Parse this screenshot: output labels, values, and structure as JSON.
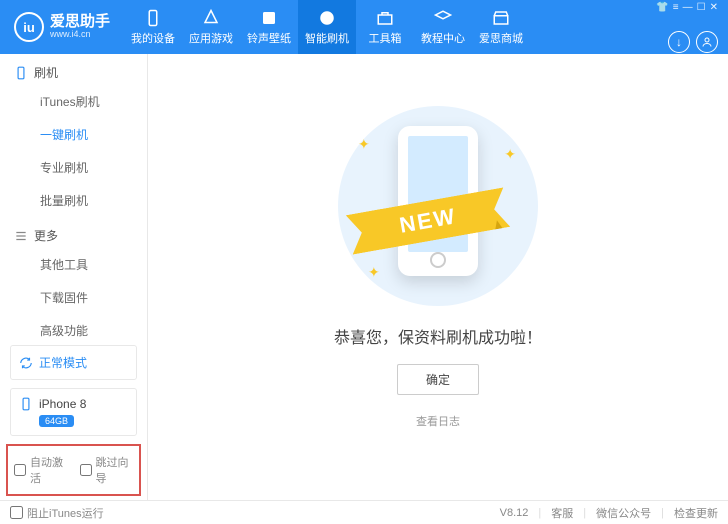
{
  "app": {
    "name": "爱思助手",
    "url": "www.i4.cn"
  },
  "nav": [
    {
      "label": "我的设备",
      "icon": "phone"
    },
    {
      "label": "应用游戏",
      "icon": "apps"
    },
    {
      "label": "铃声壁纸",
      "icon": "ringtone"
    },
    {
      "label": "智能刷机",
      "icon": "flash",
      "active": true
    },
    {
      "label": "工具箱",
      "icon": "toolbox"
    },
    {
      "label": "教程中心",
      "icon": "tutorial"
    },
    {
      "label": "爱思商城",
      "icon": "store"
    }
  ],
  "sidebar": {
    "sections": [
      {
        "title": "刷机",
        "icon": "phone",
        "items": [
          {
            "label": "iTunes刷机"
          },
          {
            "label": "一键刷机",
            "active": true
          },
          {
            "label": "专业刷机"
          },
          {
            "label": "批量刷机"
          }
        ]
      },
      {
        "title": "更多",
        "icon": "list",
        "items": [
          {
            "label": "其他工具"
          },
          {
            "label": "下载固件"
          },
          {
            "label": "高级功能"
          }
        ]
      }
    ],
    "mode": "正常模式",
    "device": {
      "name": "iPhone 8",
      "storage": "64GB"
    },
    "checks": {
      "auto_activate": "自动激活",
      "skip_guide": "跳过向导"
    }
  },
  "content": {
    "banner": "NEW",
    "message": "恭喜您，保资料刷机成功啦！",
    "ok": "确定",
    "log": "查看日志"
  },
  "footer": {
    "block_itunes": "阻止iTunes运行",
    "version": "V8.12",
    "links": [
      "客服",
      "微信公众号",
      "检查更新"
    ]
  }
}
